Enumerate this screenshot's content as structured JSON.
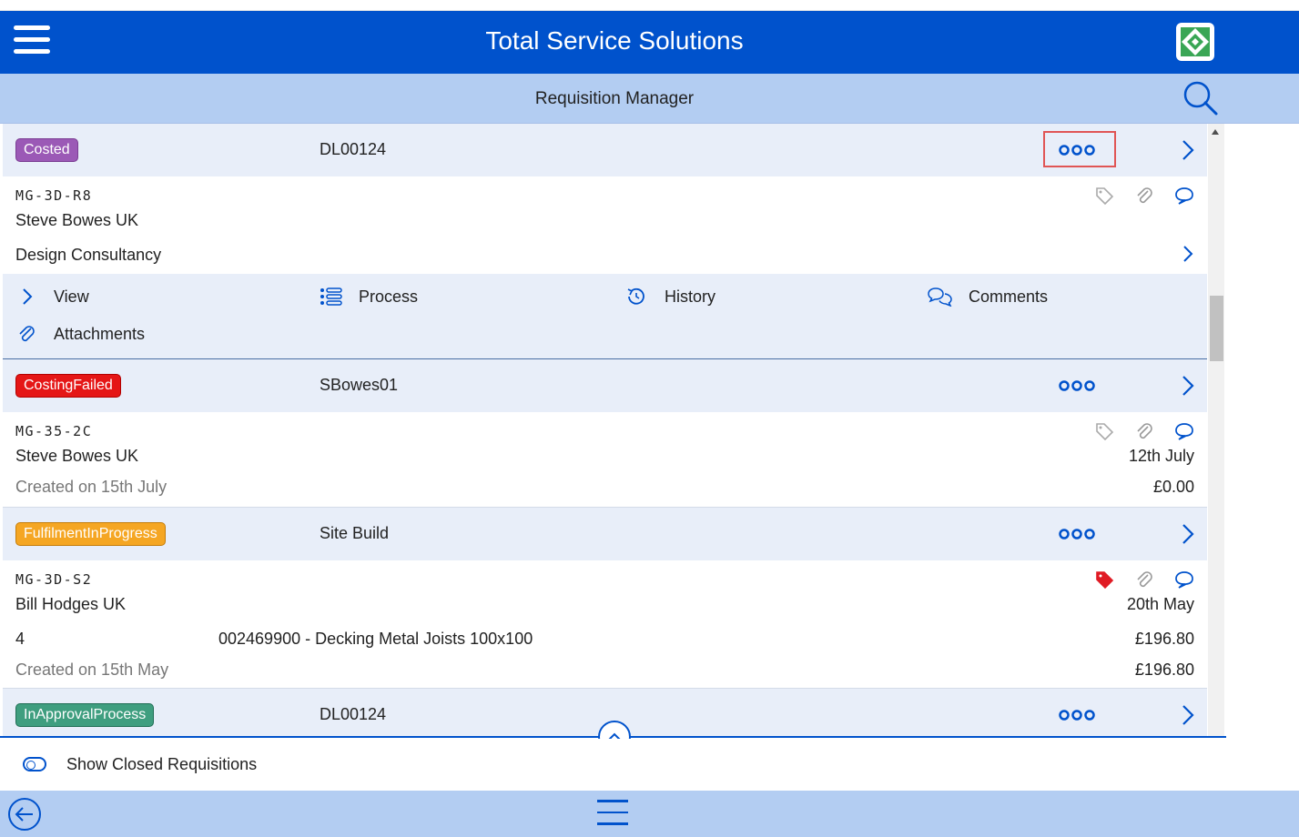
{
  "app": {
    "title": "Total Service Solutions",
    "subtitle": "Requisition Manager"
  },
  "colors": {
    "header": "#0052cc",
    "subheader": "#b3cdf2",
    "rowHead": "#e8eef9",
    "accent": "#0052cc"
  },
  "requisitions": [
    {
      "status": "Costed",
      "ref": "DL00124",
      "code": "MG-3D-R8",
      "name": "Steve Bowes UK",
      "detail": "Design Consultancy",
      "actions": {
        "view": "View",
        "process": "Process",
        "history": "History",
        "comments": "Comments",
        "attachments": "Attachments"
      }
    },
    {
      "status": "CostingFailed",
      "ref": "SBowes01",
      "code": "MG-35-2C",
      "name": "Steve Bowes UK",
      "date": "12th July",
      "created": "Created on 15th July",
      "amount": "£0.00"
    },
    {
      "status": "FulfilmentInProgress",
      "ref": "Site Build",
      "code": "MG-3D-S2",
      "name": "Bill Hodges UK",
      "date": "20th May",
      "qty": "4",
      "item": "002469900 - Decking Metal Joists 100x100",
      "line_amount": "£196.80",
      "created": "Created on 15th May",
      "amount": "£196.80"
    },
    {
      "status": "InApprovalProcess",
      "ref": "DL00124"
    }
  ],
  "footer": {
    "toggle_label": "Show Closed Requisitions"
  }
}
